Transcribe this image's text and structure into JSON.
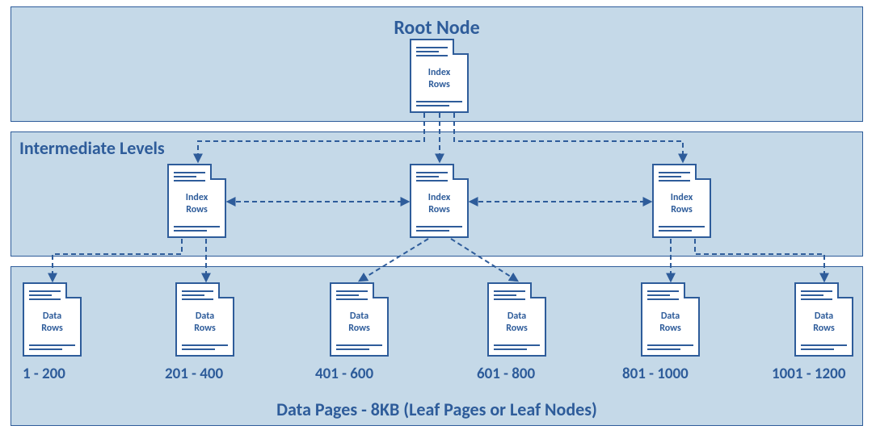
{
  "levels": {
    "root": {
      "title": "Root Node"
    },
    "mid": {
      "title": "Intermediate Levels"
    },
    "leaf": {
      "title": "Data Pages - 8KB (Leaf Pages or Leaf Nodes)"
    }
  },
  "pageTypes": {
    "index": {
      "line1": "Index",
      "line2": "Rows"
    },
    "data": {
      "line1": "Data",
      "line2": "Rows"
    }
  },
  "leafRanges": [
    "1 - 200",
    "201 - 400",
    "401 - 600",
    "601 - 800",
    "801 - 1000",
    "1001 - 1200"
  ]
}
